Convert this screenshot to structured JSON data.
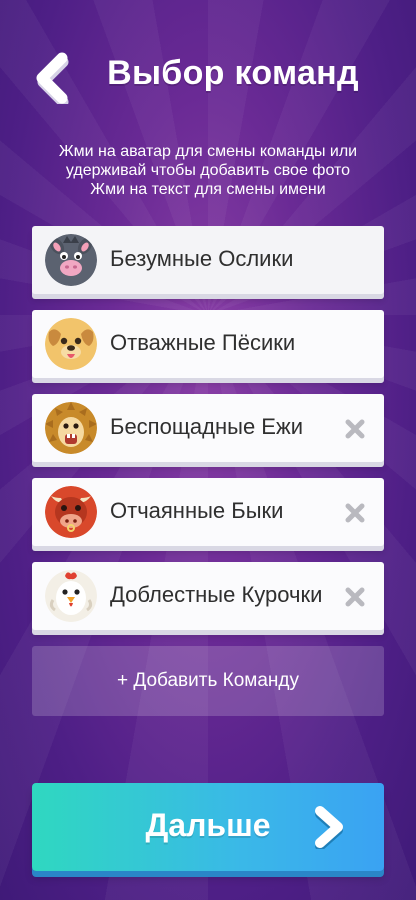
{
  "header": {
    "title": "Выбор команд",
    "back_icon": "chevron-left-icon"
  },
  "hint": {
    "line1": "Жми на аватар для смены команды или",
    "line2": "удерживай чтобы добавить свое фото",
    "line3": "Жми на текст для смены имени"
  },
  "teams": [
    {
      "name": "Безумные Ослики",
      "avatar": "donkey-avatar",
      "removable": false
    },
    {
      "name": "Отважные Пёсики",
      "avatar": "dog-avatar",
      "removable": false
    },
    {
      "name": "Беспощадные Ежи",
      "avatar": "hedgehog-avatar",
      "removable": true
    },
    {
      "name": "Отчаянные Быки",
      "avatar": "bull-avatar",
      "removable": true
    },
    {
      "name": "Доблестные Курочки",
      "avatar": "chicken-avatar",
      "removable": true
    }
  ],
  "add_team": {
    "label": "+ Добавить Команду"
  },
  "next": {
    "label": "Дальше",
    "icon": "chevron-right-icon"
  },
  "colors": {
    "background": "#5a2590",
    "next_gradient_start": "#2fd8c0",
    "next_gradient_end": "#3aa2f3",
    "remove_icon": "#b9b9bf"
  }
}
